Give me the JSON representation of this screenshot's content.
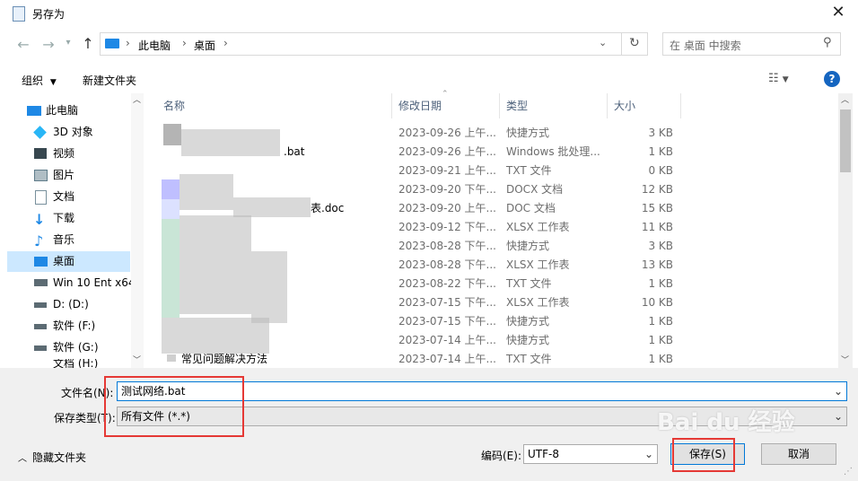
{
  "window": {
    "title": "另存为"
  },
  "nav": {
    "breadcrumb": [
      "此电脑",
      "桌面"
    ],
    "search_placeholder": "在 桌面 中搜索"
  },
  "toolbar": {
    "organize": "组织",
    "new_folder": "新建文件夹"
  },
  "sidebar": {
    "items": [
      {
        "label": "此电脑"
      },
      {
        "label": "3D 对象"
      },
      {
        "label": "视频"
      },
      {
        "label": "图片"
      },
      {
        "label": "文档"
      },
      {
        "label": "下载"
      },
      {
        "label": "音乐"
      },
      {
        "label": "桌面"
      },
      {
        "label": "Win 10 Ent x64"
      },
      {
        "label": "D: (D:)"
      },
      {
        "label": "软件 (F:)"
      },
      {
        "label": "软件 (G:)"
      },
      {
        "label": "文档 (H:)"
      }
    ]
  },
  "columns": {
    "name": "名称",
    "date": "修改日期",
    "type": "类型",
    "size": "大小"
  },
  "files": [
    {
      "name": "",
      "date": "2023-09-26 上午...",
      "type": "快捷方式",
      "size": "3 KB"
    },
    {
      "name": ".bat",
      "date": "2023-09-26 上午...",
      "type": "Windows 批处理...",
      "size": "1 KB"
    },
    {
      "name": "",
      "date": "2023-09-21 上午...",
      "type": "TXT 文件",
      "size": "0 KB"
    },
    {
      "name": "",
      "date": "2023-09-20 下午...",
      "type": "DOCX 文档",
      "size": "12 KB"
    },
    {
      "name": "表.doc",
      "date": "2023-09-20 上午...",
      "type": "DOC 文档",
      "size": "15 KB"
    },
    {
      "name": "",
      "date": "2023-09-12 下午...",
      "type": "XLSX 工作表",
      "size": "11 KB"
    },
    {
      "name": "",
      "date": "2023-08-28 下午...",
      "type": "快捷方式",
      "size": "3 KB"
    },
    {
      "name": "",
      "date": "2023-08-28 下午...",
      "type": "XLSX 工作表",
      "size": "13 KB"
    },
    {
      "name": "",
      "date": "2023-08-22 下午...",
      "type": "TXT 文件",
      "size": "1 KB"
    },
    {
      "name": "",
      "date": "2023-07-15 下午...",
      "type": "XLSX 工作表",
      "size": "10 KB"
    },
    {
      "name": "",
      "date": "2023-07-15 下午...",
      "type": "快捷方式",
      "size": "1 KB"
    },
    {
      "name": "",
      "date": "2023-07-14 上午...",
      "type": "快捷方式",
      "size": "1 KB"
    },
    {
      "name": "常见问题解决方法",
      "date": "2023-07-14 上午...",
      "type": "TXT 文件",
      "size": "1 KB"
    }
  ],
  "form": {
    "filename_label": "文件名(N):",
    "filename_value": "测试网络.bat",
    "filetype_label": "保存类型(T):",
    "filetype_value": "所有文件  (*.*)",
    "hide_folders": "隐藏文件夹",
    "encoding_label": "编码(E):",
    "encoding_value": "UTF-8",
    "save": "保存(S)",
    "cancel": "取消"
  },
  "watermark": "Bai du 经验",
  "colors": {
    "selection": "#cce8ff",
    "highlight": "#e53935",
    "accent": "#0078d7"
  }
}
